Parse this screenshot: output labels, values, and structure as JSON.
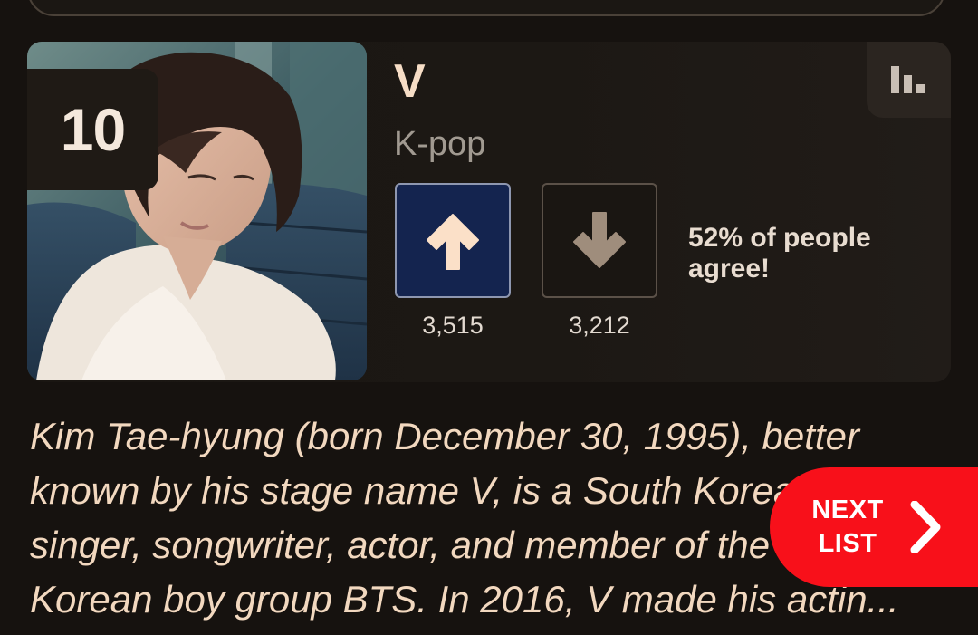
{
  "item": {
    "rank": "10",
    "name": "V",
    "category": "K-pop",
    "upvotes": "3,515",
    "downvotes": "3,212",
    "agreement": "52% of people agree!",
    "description": [
      "Kim Tae-hyung (born December 30, 1995), better",
      "known by his stage name V, is a South Korean",
      "singer, songwriter, actor, and member of the",
      "Korean boy group BTS. In 2016, V made his actin..."
    ]
  },
  "next_button": {
    "line1": "NEXT",
    "line2": "LIST"
  },
  "icons": {
    "stats": "bar-chart-icon",
    "upvote": "arrow-up-icon",
    "downvote": "arrow-down-icon",
    "next": "chevron-right-icon"
  },
  "colors": {
    "background": "#16120f",
    "title": "#f6ddc6",
    "description": "#f2d8bf",
    "upvote_bg": "#14244f",
    "accent_red": "#f8101a"
  }
}
